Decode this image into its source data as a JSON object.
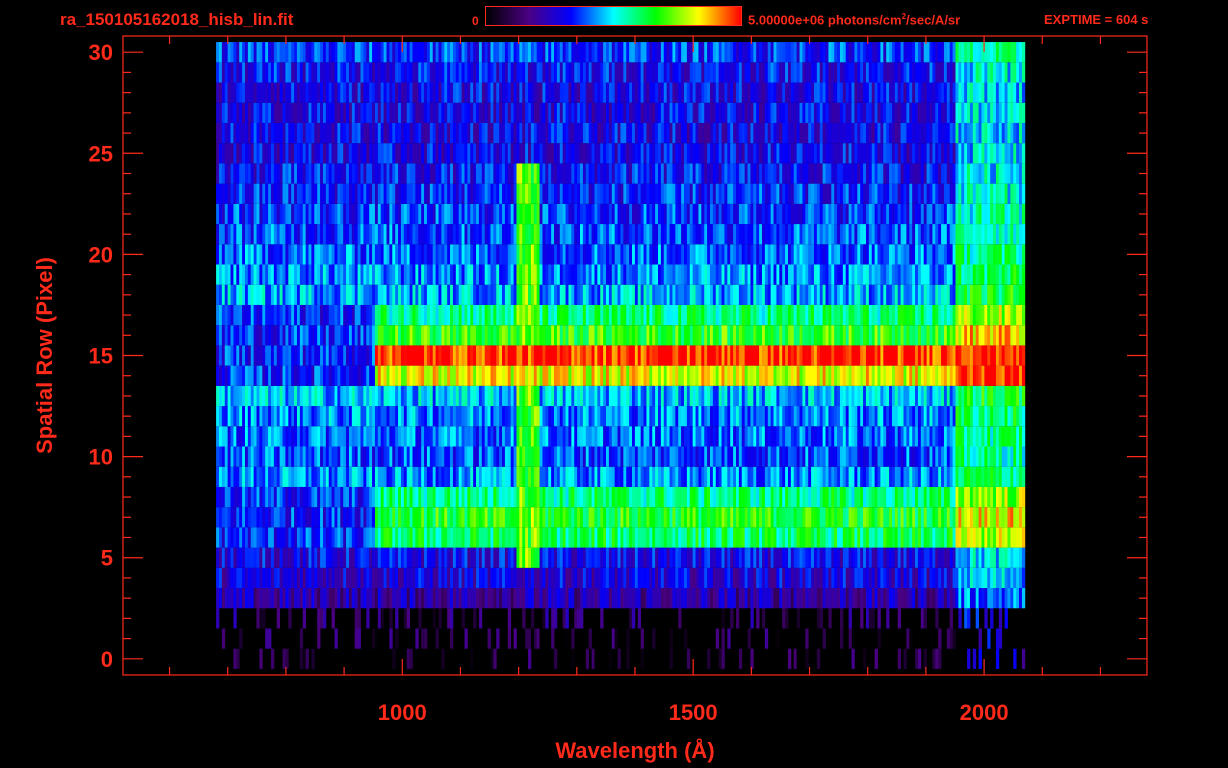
{
  "header": {
    "file_title": "ra_150105162018_hisb_lin.fit",
    "colorbar_min": "0",
    "colorbar_max_prefix": "5.00000e+06 photons/cm",
    "colorbar_max_sup": "2",
    "colorbar_max_suffix": "/sec/A/sr",
    "exptime": "EXPTIME = 604 s"
  },
  "colors": {
    "axis": "#ff2a1a",
    "background": "#000000",
    "colormap": [
      "#000000",
      "#4b0082",
      "#0000ff",
      "#00ffff",
      "#00ff00",
      "#ffff00",
      "#ff0000"
    ]
  },
  "chart_data": {
    "type": "heatmap",
    "xlabel": "Wavelength (Å)",
    "ylabel": "Spatial Row (Pixel)",
    "xlim": [
      520,
      2280
    ],
    "ylim": [
      -0.8,
      30.8
    ],
    "x_ticks": [
      1000,
      1500,
      2000
    ],
    "y_ticks": [
      0,
      5,
      10,
      15,
      20,
      25,
      30
    ],
    "x_coverage": [
      680,
      2070
    ],
    "row_levels": [
      {
        "row": 0,
        "level": 0.08
      },
      {
        "row": 1,
        "level": 0.1
      },
      {
        "row": 2,
        "level": 0.14
      },
      {
        "row": 3,
        "level": 0.22
      },
      {
        "row": 4,
        "level": 0.28
      },
      {
        "row": 5,
        "level": 0.3
      },
      {
        "row": 6,
        "level": 0.6
      },
      {
        "row": 7,
        "level": 0.66
      },
      {
        "row": 8,
        "level": 0.58
      },
      {
        "row": 9,
        "level": 0.42
      },
      {
        "row": 10,
        "level": 0.38
      },
      {
        "row": 11,
        "level": 0.4
      },
      {
        "row": 12,
        "level": 0.42
      },
      {
        "row": 13,
        "level": 0.46
      },
      {
        "row": 14,
        "level": 0.82
      },
      {
        "row": 15,
        "level": 0.98
      },
      {
        "row": 16,
        "level": 0.68
      },
      {
        "row": 17,
        "level": 0.58
      },
      {
        "row": 18,
        "level": 0.45
      },
      {
        "row": 19,
        "level": 0.42
      },
      {
        "row": 20,
        "level": 0.4
      },
      {
        "row": 21,
        "level": 0.38
      },
      {
        "row": 22,
        "level": 0.36
      },
      {
        "row": 23,
        "level": 0.34
      },
      {
        "row": 24,
        "level": 0.32
      },
      {
        "row": 25,
        "level": 0.3
      },
      {
        "row": 26,
        "level": 0.3
      },
      {
        "row": 27,
        "level": 0.3
      },
      {
        "row": 28,
        "level": 0.3
      },
      {
        "row": 29,
        "level": 0.32
      },
      {
        "row": 30,
        "level": 0.36
      }
    ],
    "emission_line": {
      "wavelength": 1216,
      "rows": [
        5,
        24
      ],
      "level": 0.72
    },
    "grid": false
  }
}
